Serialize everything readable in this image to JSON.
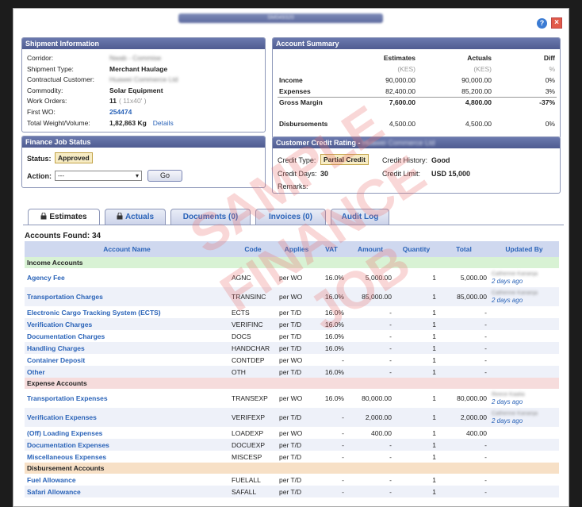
{
  "window": {
    "title": "SM049320",
    "help_icon": "?",
    "close_icon": "×"
  },
  "shipment": {
    "title": "Shipment Information",
    "rows": [
      {
        "label": "Corridor:",
        "value": "Nwab - Commise",
        "blur": true
      },
      {
        "label": "Shipment Type:",
        "value": "Merchant Haulage"
      },
      {
        "label": "Contractual Customer:",
        "value": "Huawei Commerce Ltd",
        "blur": true
      },
      {
        "label": "Commodity:",
        "value": "Solar Equipment"
      },
      {
        "label": "Work Orders:",
        "value": "11",
        "extra": "( 11x40' )"
      },
      {
        "label": "First WO:",
        "value": "254474",
        "link": true
      },
      {
        "label": "Total Weight/Volume:",
        "value": "1,82,863 Kg",
        "extra_link": "Details"
      }
    ]
  },
  "summary": {
    "title": "Account Summary",
    "headers": [
      "Estimates",
      "Actuals",
      "Diff"
    ],
    "units": [
      "(KES)",
      "(KES)",
      "%"
    ],
    "rows": [
      {
        "label": "Income",
        "est": "90,000.00",
        "act": "90,000.00",
        "diff": "0%"
      },
      {
        "label": "Expenses",
        "est": "82,400.00",
        "act": "85,200.00",
        "diff": "3%"
      },
      {
        "label": "Gross Margin",
        "est": "7,600.00",
        "act": "4,800.00",
        "diff": "-37%"
      },
      {
        "label": "Disbursements",
        "est": "4,500.00",
        "act": "4,500.00",
        "diff": "0%"
      }
    ]
  },
  "finance": {
    "title": "Finance Job Status",
    "status_label": "Status:",
    "status": "Approved",
    "action_label": "Action:",
    "action_value": "---",
    "go": "Go"
  },
  "credit": {
    "title": "Customer Credit Rating -",
    "customer": "Huawei Commerce Ltd",
    "type_label": "Credit Type:",
    "type": "Partial Credit",
    "history_label": "Credit History:",
    "history": "Good",
    "days_label": "Credit Days:",
    "days": "30",
    "limit_label": "Credit Limit:",
    "limit": "USD 15,000",
    "remarks_label": "Remarks:"
  },
  "tabs": [
    "Estimates",
    "Actuals",
    "Documents (0)",
    "Invoices (0)",
    "Audit Log"
  ],
  "accounts_found": "Accounts Found: 34",
  "grid": {
    "headers": [
      "Account Name",
      "Code",
      "Applies",
      "VAT",
      "Amount",
      "Quantity",
      "Total",
      "Updated By"
    ],
    "sections": [
      {
        "name": "Income Accounts",
        "kind": "income",
        "rows": [
          {
            "name": "Agency Fee",
            "code": "AGNC",
            "applies": "per WO",
            "vat": "16.0%",
            "amount": "5,000.00",
            "qty": "1",
            "total": "5,000.00",
            "user": "Catherine Kananja",
            "ago": "2 days ago"
          },
          {
            "name": "Transportation Charges",
            "code": "TRANSINC",
            "applies": "per WO",
            "vat": "16.0%",
            "amount": "85,000.00",
            "qty": "1",
            "total": "85,000.00",
            "user": "Catherine Kananja",
            "ago": "2 days ago"
          },
          {
            "name": "Electronic Cargo Tracking System (ECTS)",
            "code": "ECTS",
            "applies": "per T/D",
            "vat": "16.0%",
            "amount": "-",
            "qty": "1",
            "total": "-"
          },
          {
            "name": "Verification Charges",
            "code": "VERIFINC",
            "applies": "per T/D",
            "vat": "16.0%",
            "amount": "-",
            "qty": "1",
            "total": "-"
          },
          {
            "name": "Documentation Charges",
            "code": "DOCS",
            "applies": "per T/D",
            "vat": "16.0%",
            "amount": "-",
            "qty": "1",
            "total": "-"
          },
          {
            "name": "Handling Charges",
            "code": "HANDCHAR",
            "applies": "per T/D",
            "vat": "16.0%",
            "amount": "-",
            "qty": "1",
            "total": "-"
          },
          {
            "name": "Container Deposit",
            "code": "CONTDEP",
            "applies": "per WO",
            "vat": "-",
            "amount": "-",
            "qty": "1",
            "total": "-"
          },
          {
            "name": "Other",
            "code": "OTH",
            "applies": "per T/D",
            "vat": "16.0%",
            "amount": "-",
            "qty": "1",
            "total": "-"
          }
        ]
      },
      {
        "name": "Expense Accounts",
        "kind": "exp",
        "rows": [
          {
            "name": "Transportation Expenses",
            "code": "TRANSEXP",
            "applies": "per WO",
            "vat": "16.0%",
            "amount": "80,000.00",
            "qty": "1",
            "total": "80,000.00",
            "user": "Reece Kaalia",
            "ago": "2 days ago"
          },
          {
            "name": "Verification Expenses",
            "code": "VERIFEXP",
            "applies": "per T/D",
            "vat": "-",
            "amount": "2,000.00",
            "qty": "1",
            "total": "2,000.00",
            "user": "Catherine Kananja",
            "ago": "2 days ago"
          },
          {
            "name": "(Off) Loading Expenses",
            "code": "LOADEXP",
            "applies": "per WO",
            "vat": "-",
            "amount": "400.00",
            "qty": "1",
            "total": "400.00"
          },
          {
            "name": "Documentation Expenses",
            "code": "DOCUEXP",
            "applies": "per T/D",
            "vat": "-",
            "amount": "-",
            "qty": "1",
            "total": "-"
          },
          {
            "name": "Miscellaneous Expenses",
            "code": "MISCESP",
            "applies": "per T/D",
            "vat": "-",
            "amount": "-",
            "qty": "1",
            "total": "-"
          }
        ]
      },
      {
        "name": "Disbursement Accounts",
        "kind": "disb",
        "rows": [
          {
            "name": "Fuel Allowance",
            "code": "FUELALL",
            "applies": "per T/D",
            "vat": "-",
            "amount": "-",
            "qty": "1",
            "total": "-"
          },
          {
            "name": "Safari Allowance",
            "code": "SAFALL",
            "applies": "per T/D",
            "vat": "-",
            "amount": "-",
            "qty": "1",
            "total": "-"
          }
        ]
      }
    ]
  },
  "watermark": [
    "SAMPLE",
    "FINANCE",
    "JOB"
  ]
}
